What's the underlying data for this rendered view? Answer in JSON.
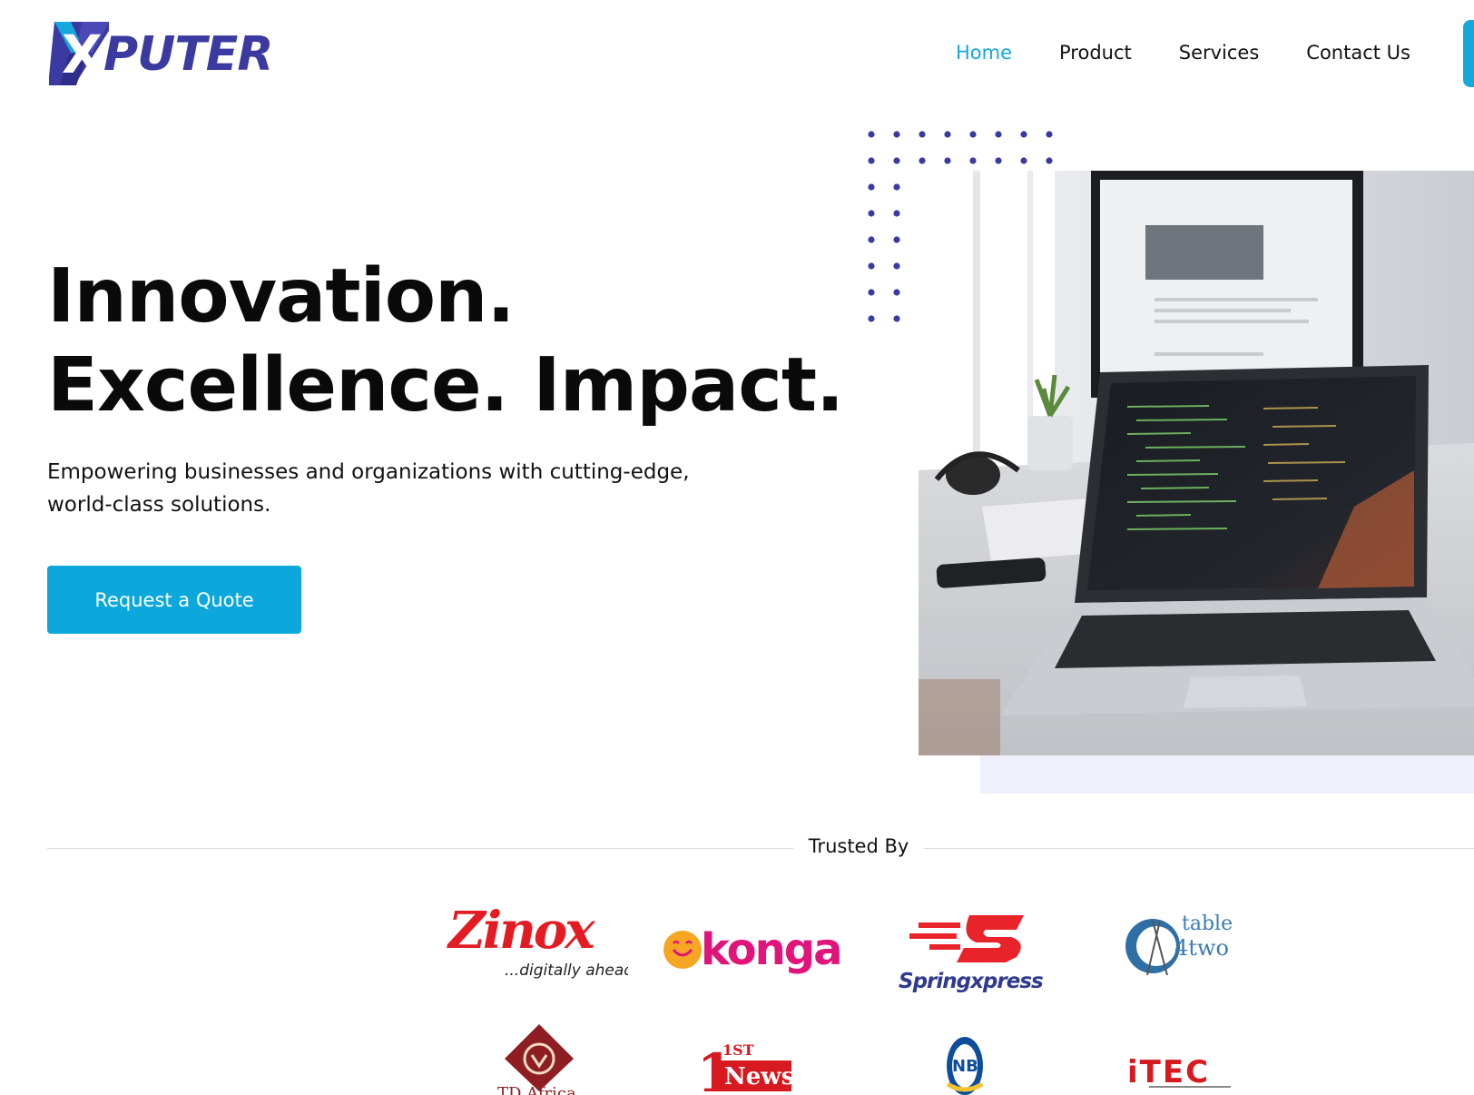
{
  "brand": {
    "logo_text": "PUTER",
    "logo_letter": "X",
    "accent": "#14a8dc",
    "logo_color": "#3b3aa0"
  },
  "nav": {
    "items": [
      {
        "label": "Home",
        "active": true
      },
      {
        "label": "Product",
        "active": false
      },
      {
        "label": "Services",
        "active": false
      },
      {
        "label": "Contact Us",
        "active": false
      }
    ]
  },
  "hero": {
    "title_line1": "Innovation.",
    "title_line2": "Excellence. Impact.",
    "subtitle": "Empowering businesses and organizations with cutting-edge, world-class solutions.",
    "cta_label": "Request a Quote",
    "image": "laptop-and-monitor-with-code-photo"
  },
  "trusted": {
    "label": "Trusted By",
    "logos": [
      {
        "name": "Zinox",
        "tagline": "...digitally ahead"
      },
      {
        "name": "konga"
      },
      {
        "name": "Springxpress"
      },
      {
        "name": "table",
        "line2": "4two"
      },
      {
        "name": "TD Africa"
      },
      {
        "name": "1ST",
        "line2": "News"
      },
      {
        "name": "NB"
      },
      {
        "name": "iTEC"
      }
    ]
  }
}
